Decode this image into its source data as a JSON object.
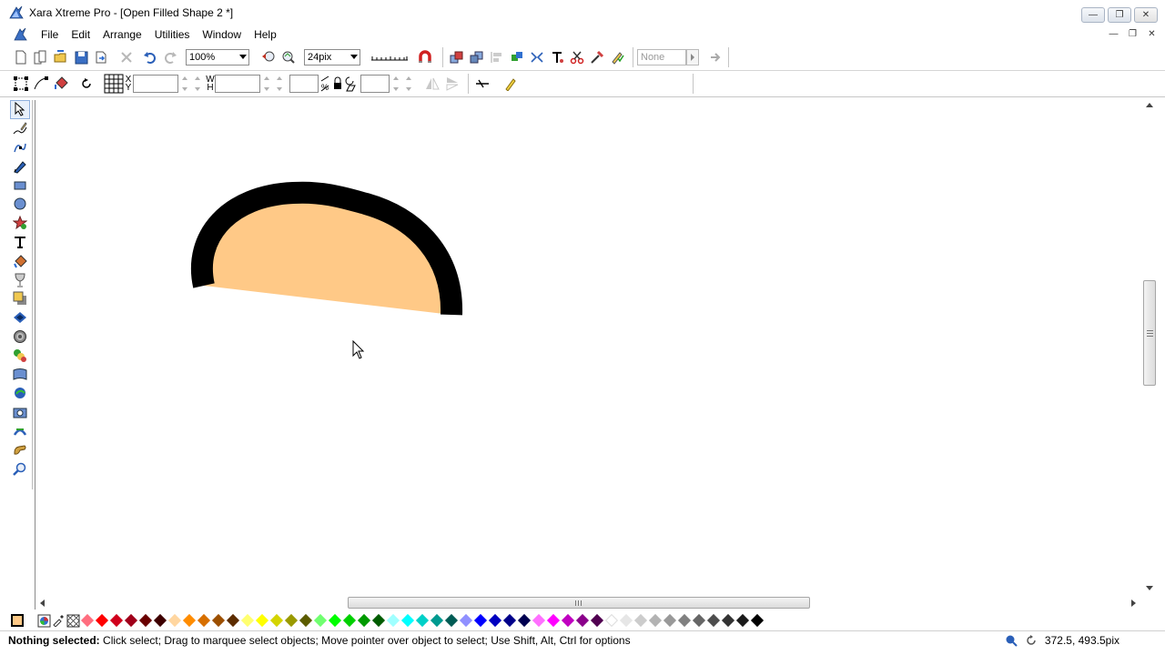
{
  "window": {
    "title": "Xara Xtreme Pro - [Open Filled Shape 2 *]",
    "controls": [
      "—",
      "❐",
      "✕"
    ],
    "mdi_controls": [
      "—",
      "❐",
      "✕"
    ]
  },
  "menu": {
    "items": [
      "File",
      "Edit",
      "Arrange",
      "Utilities",
      "Window",
      "Help"
    ]
  },
  "toolbar_top": {
    "zoom": "100%",
    "line_width": "24pix",
    "feather_value": "None"
  },
  "toolbar_info": {
    "x_label": "X",
    "y_label": "Y",
    "w_label": "W",
    "h_label": "H",
    "x_value": "",
    "y_value": "",
    "w_value": "",
    "h_value": "",
    "scale_value": "",
    "rotate_value": ""
  },
  "tools": [
    "selector-tool",
    "freehand-tool",
    "shape-editor-tool",
    "pen-tool",
    "rectangle-tool",
    "ellipse-tool",
    "quickshape-tool",
    "text-tool",
    "fill-tool",
    "transparency-tool",
    "shadow-tool",
    "bevel-tool",
    "contour-tool",
    "blend-tool",
    "mould-tool",
    "live-effects-tool",
    "photo-tool",
    "slice-tool",
    "push-tool",
    "zoom-tool"
  ],
  "canvas": {
    "shape_fill": "#ffc987",
    "shape_stroke": "#000000"
  },
  "palette": {
    "colors": [
      "#ff6e7f",
      "#ff0000",
      "#d0001c",
      "#a0001a",
      "#6a0000",
      "#3e0000",
      "#ffd6a0",
      "#ff8c00",
      "#d76f00",
      "#9c4f00",
      "#5c2c00",
      "#ffff70",
      "#ffff00",
      "#d4d400",
      "#9a9a00",
      "#5c5c00",
      "#70ff70",
      "#00ff00",
      "#00d000",
      "#009a00",
      "#005c00",
      "#a0ffff",
      "#00ffff",
      "#00d0c8",
      "#009a90",
      "#005c55",
      "#9090ff",
      "#0000ff",
      "#0000c0",
      "#00008a",
      "#000050",
      "#ff70ff",
      "#ff00ff",
      "#c000c0",
      "#8a008a",
      "#500050",
      "#ffffff",
      "#e6e6e6",
      "#cccccc",
      "#b3b3b3",
      "#999999",
      "#808080",
      "#666666",
      "#4d4d4d",
      "#333333",
      "#1a1a1a",
      "#000000"
    ]
  },
  "status": {
    "state": "Nothing selected:",
    "hint": " Click select; Drag to marquee select objects; Move pointer over object to select; Use Shift, Alt, Ctrl for options",
    "coords": "372.5, 493.5pix"
  }
}
